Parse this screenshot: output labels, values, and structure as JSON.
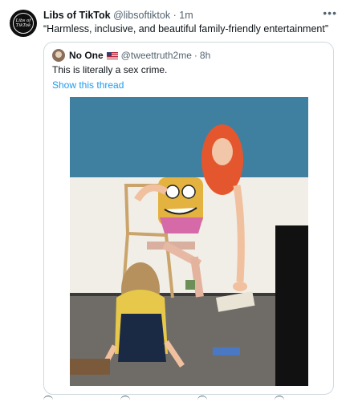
{
  "tweet": {
    "display_name": "Libs of TikTok",
    "handle": "@libsoftiktok",
    "separator": "·",
    "time": "1m",
    "text": "“Harmless, inclusive, and beautiful family-friendly entertainment”",
    "more_icon": "more-horizontal-icon",
    "avatar_logo_text": "Libs of TikTok"
  },
  "quoted_tweet": {
    "display_name": "No One",
    "flag_icon": "us-flag-icon",
    "handle": "@tweettruth2me",
    "separator": "·",
    "time": "8h",
    "text": "This is literally a sex crime.",
    "show_thread_label": "Show this thread",
    "link_color": "#1d9bf0"
  },
  "action_icons": [
    "reply-icon",
    "retweet-icon",
    "like-icon",
    "share-icon"
  ]
}
